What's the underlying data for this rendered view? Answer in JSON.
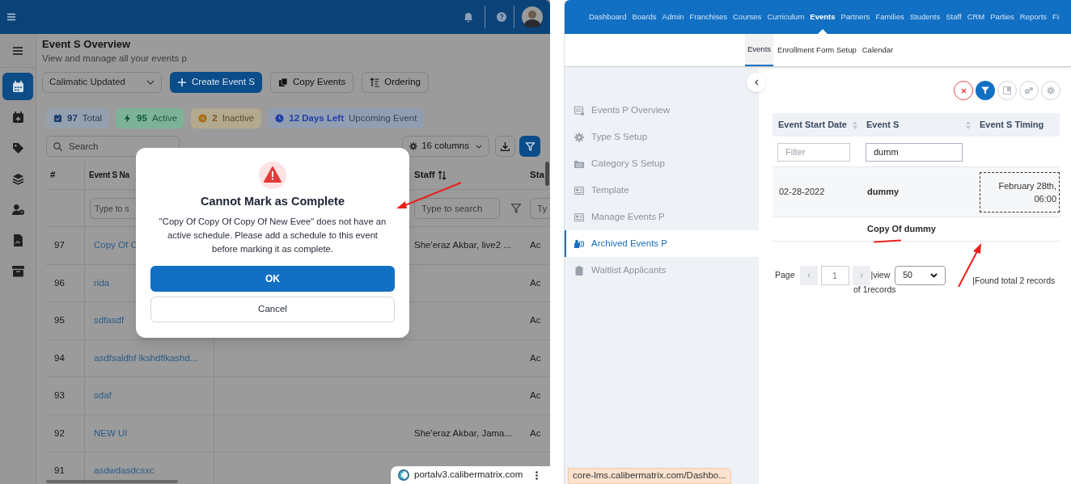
{
  "left_window": {
    "side_nav": [
      {
        "selected": true
      },
      {
        "selected": false
      },
      {
        "selected": false
      },
      {
        "selected": false
      },
      {
        "selected": false
      },
      {
        "selected": false
      },
      {
        "selected": false
      }
    ],
    "page_title": "Event S Overview",
    "page_subtitle": "View and manage all your events p",
    "toolbar": {
      "dropdown": "Calimatic Updated",
      "buttons": [
        {
          "label": "Create Event S",
          "kind": "primary"
        },
        {
          "label": "Copy Events",
          "kind": "copy"
        },
        {
          "label": "Ordering",
          "kind": "order"
        }
      ]
    },
    "stats": [
      {
        "value": "97",
        "label": "Total",
        "kind": "total"
      },
      {
        "value": "95",
        "label": "Active",
        "kind": "active"
      },
      {
        "value": "2",
        "label": "Inactive",
        "kind": "inactive"
      },
      {
        "value": "12 Days Left",
        "label": "Upcoming Event",
        "kind": "upcoming"
      }
    ],
    "search": {
      "placeholder": "Search"
    },
    "columns_button": "16 columns",
    "table": {
      "columns": [
        "#",
        "Event S Na",
        "Staff",
        "Sta"
      ],
      "filter_placeholders": [
        "Type to s",
        "Type to search",
        "Ty"
      ],
      "rows": [
        {
          "number": "97",
          "name": "Copy Of C",
          "staff": "She'eraz Akbar, live2 ...",
          "status": "Ac"
        },
        {
          "number": "96",
          "name": "rida",
          "staff": "",
          "status": "Ac"
        },
        {
          "number": "95",
          "name": "sdfasdf",
          "staff": "",
          "status": "Ac"
        },
        {
          "number": "94",
          "name": "asdfsaldhf lkshdflkashd...",
          "staff": "",
          "status": "Ac"
        },
        {
          "number": "93",
          "name": "sdaf",
          "staff": "",
          "status": "Ac"
        },
        {
          "number": "92",
          "name": "NEW UI",
          "staff": "She'eraz Akbar, Jama...",
          "status": "Ac"
        },
        {
          "number": "91",
          "name": "asdwdasdcsxc",
          "staff": "",
          "status": ""
        }
      ]
    },
    "dialog": {
      "title": "Cannot Mark as Complete",
      "message": "\"Copy Of Copy Of Copy Of New Evee\" does not have an active schedule. Please add a schedule to this event before marking it as complete.",
      "buttons": [
        {
          "label": "OK",
          "kind": "primary"
        },
        {
          "label": "Cancel",
          "kind": "secondary"
        }
      ]
    },
    "url_popup": "portalv3.calibermatrix.com"
  },
  "right_window": {
    "nav": [
      {
        "label": "Dashboard",
        "selected": false
      },
      {
        "label": "Boards",
        "selected": false
      },
      {
        "label": "Admin",
        "selected": false
      },
      {
        "label": "Franchises",
        "selected": false
      },
      {
        "label": "Courses",
        "selected": false
      },
      {
        "label": "Curriculum",
        "selected": false
      },
      {
        "label": "Events",
        "selected": true
      },
      {
        "label": "Partners",
        "selected": false
      },
      {
        "label": "Families",
        "selected": false
      },
      {
        "label": "Students",
        "selected": false
      },
      {
        "label": "Staff",
        "selected": false
      },
      {
        "label": "CRM",
        "selected": false
      },
      {
        "label": "Parties",
        "selected": false
      },
      {
        "label": "Reports",
        "selected": false
      },
      {
        "label": "Fi",
        "selected": false
      }
    ],
    "subtabs": [
      {
        "label": "Events",
        "selected": true
      },
      {
        "label": "Enrollment Form Setup",
        "selected": false
      },
      {
        "label": "Calendar",
        "selected": false
      }
    ],
    "sidebar": [
      {
        "label": "Events P Overview",
        "selected": false
      },
      {
        "label": "Type S Setup",
        "selected": false
      },
      {
        "label": "Category S Setup",
        "selected": false
      },
      {
        "label": "Template",
        "selected": false
      },
      {
        "label": "Manage Events P",
        "selected": false
      },
      {
        "label": "Archived Events P",
        "selected": true
      },
      {
        "label": "Waitlist Applicants",
        "selected": false
      }
    ],
    "table": {
      "columns": [
        {
          "label": "Event Start Date",
          "sortable": true
        },
        {
          "label": "Event S",
          "sortable": true
        },
        {
          "label": "Event S Timing",
          "sortable": false
        }
      ],
      "filters": [
        {
          "placeholder": "Filter"
        },
        {
          "value": "dumm"
        }
      ],
      "rows": [
        {
          "date": "02-28-2022",
          "name": "dummy",
          "timing": [
            "February 28th,",
            "06:00"
          ]
        },
        {
          "date": "",
          "name": "Copy Of dummy",
          "timing": []
        }
      ]
    },
    "pagination": {
      "page_label": "Page",
      "page": "1",
      "view_label": "|view",
      "page_size": "50",
      "of_records": "of 1records",
      "found": "|Found total 2 records"
    },
    "status_url": "core-lms.calibermatrix.com/Dashbo..."
  }
}
